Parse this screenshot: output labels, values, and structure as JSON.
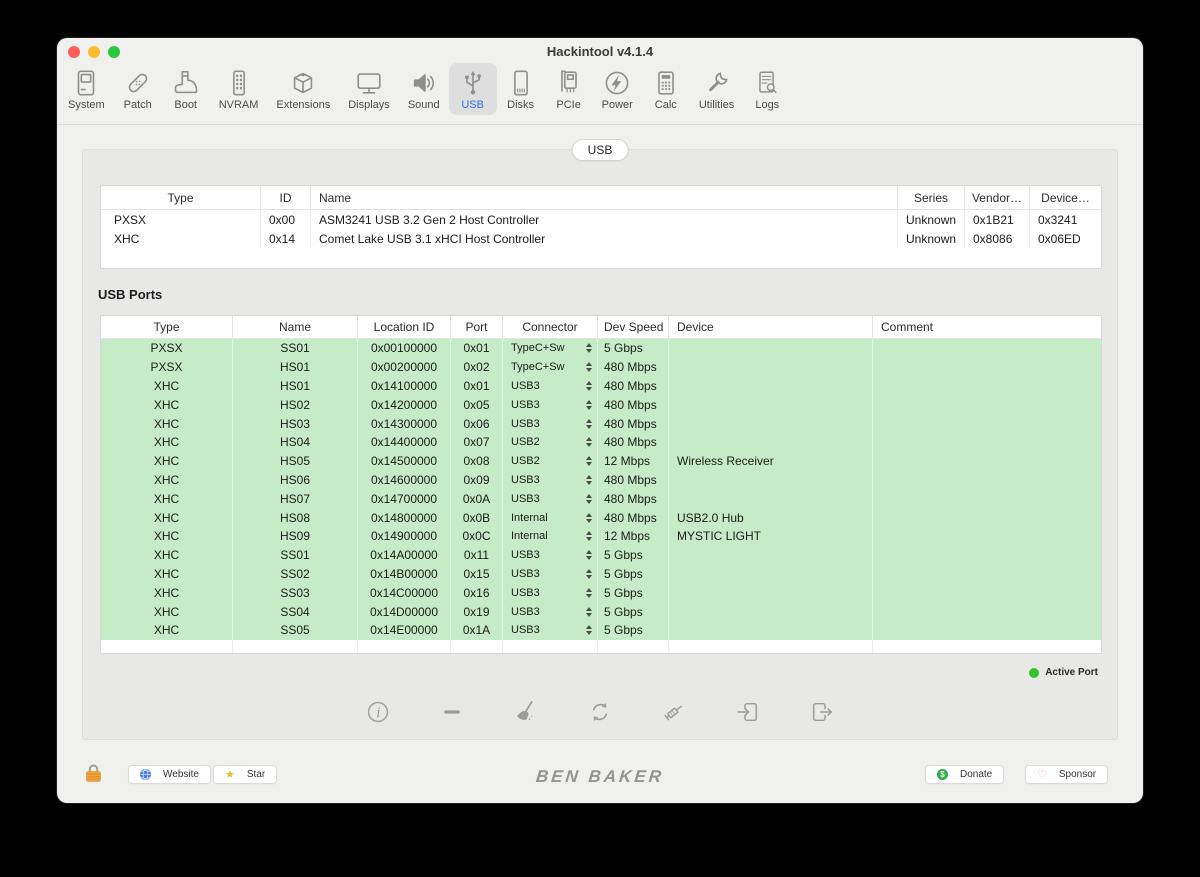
{
  "window": {
    "title": "Hackintool v4.1.4"
  },
  "toolbar": {
    "items": [
      {
        "label": "System",
        "icon": "system",
        "active": false
      },
      {
        "label": "Patch",
        "icon": "patch",
        "active": false
      },
      {
        "label": "Boot",
        "icon": "boot",
        "active": false
      },
      {
        "label": "NVRAM",
        "icon": "nvram",
        "active": false
      },
      {
        "label": "Extensions",
        "icon": "extensions",
        "active": false
      },
      {
        "label": "Displays",
        "icon": "displays",
        "active": false
      },
      {
        "label": "Sound",
        "icon": "sound",
        "active": false
      },
      {
        "label": "USB",
        "icon": "usb",
        "active": true
      },
      {
        "label": "Disks",
        "icon": "disks",
        "active": false
      },
      {
        "label": "PCIe",
        "icon": "pcie",
        "active": false
      },
      {
        "label": "Power",
        "icon": "power",
        "active": false
      },
      {
        "label": "Calc",
        "icon": "calc",
        "active": false
      },
      {
        "label": "Utilities",
        "icon": "utilities",
        "active": false
      },
      {
        "label": "Logs",
        "icon": "logs",
        "active": false
      }
    ]
  },
  "tab": {
    "label": "USB"
  },
  "controllers": {
    "headers": [
      "Type",
      "ID",
      "Name",
      "Series",
      "Vendor…",
      "Device…"
    ],
    "rows": [
      [
        "PXSX",
        "0x00",
        "ASM3241 USB 3.2 Gen 2 Host Controller",
        "Unknown",
        "0x1B21",
        "0x3241"
      ],
      [
        "XHC",
        "0x14",
        "Comet Lake USB 3.1 xHCI Host Controller",
        "Unknown",
        "0x8086",
        "0x06ED"
      ]
    ]
  },
  "usb_ports": {
    "title": "USB Ports",
    "headers": [
      "Type",
      "Name",
      "Location ID",
      "Port",
      "Connector",
      "Dev Speed",
      "Device",
      "Comment"
    ],
    "rows": [
      [
        "PXSX",
        "SS01",
        "0x00100000",
        "0x01",
        "TypeC+Sw",
        "5 Gbps",
        "",
        ""
      ],
      [
        "PXSX",
        "HS01",
        "0x00200000",
        "0x02",
        "TypeC+Sw",
        "480 Mbps",
        "",
        ""
      ],
      [
        "XHC",
        "HS01",
        "0x14100000",
        "0x01",
        "USB3",
        "480 Mbps",
        "",
        ""
      ],
      [
        "XHC",
        "HS02",
        "0x14200000",
        "0x05",
        "USB3",
        "480 Mbps",
        "",
        ""
      ],
      [
        "XHC",
        "HS03",
        "0x14300000",
        "0x06",
        "USB3",
        "480 Mbps",
        "",
        ""
      ],
      [
        "XHC",
        "HS04",
        "0x14400000",
        "0x07",
        "USB2",
        "480 Mbps",
        "",
        ""
      ],
      [
        "XHC",
        "HS05",
        "0x14500000",
        "0x08",
        "USB2",
        "12 Mbps",
        "Wireless Receiver",
        ""
      ],
      [
        "XHC",
        "HS06",
        "0x14600000",
        "0x09",
        "USB3",
        "480 Mbps",
        "",
        ""
      ],
      [
        "XHC",
        "HS07",
        "0x14700000",
        "0x0A",
        "USB3",
        "480 Mbps",
        "",
        ""
      ],
      [
        "XHC",
        "HS08",
        "0x14800000",
        "0x0B",
        "Internal",
        "480 Mbps",
        "USB2.0 Hub",
        ""
      ],
      [
        "XHC",
        "HS09",
        "0x14900000",
        "0x0C",
        "Internal",
        "12 Mbps",
        "MYSTIC LIGHT",
        ""
      ],
      [
        "XHC",
        "SS01",
        "0x14A00000",
        "0x11",
        "USB3",
        "5 Gbps",
        "",
        ""
      ],
      [
        "XHC",
        "SS02",
        "0x14B00000",
        "0x15",
        "USB3",
        "5 Gbps",
        "",
        ""
      ],
      [
        "XHC",
        "SS03",
        "0x14C00000",
        "0x16",
        "USB3",
        "5 Gbps",
        "",
        ""
      ],
      [
        "XHC",
        "SS04",
        "0x14D00000",
        "0x19",
        "USB3",
        "5 Gbps",
        "",
        ""
      ],
      [
        "XHC",
        "SS05",
        "0x14E00000",
        "0x1A",
        "USB3",
        "5 Gbps",
        "",
        ""
      ]
    ]
  },
  "legend": {
    "active_port_label": "Active Port",
    "active_color": "#2ec62e"
  },
  "actions": {
    "items": [
      {
        "name": "info"
      },
      {
        "name": "remove"
      },
      {
        "name": "clean"
      },
      {
        "name": "refresh"
      },
      {
        "name": "inject"
      },
      {
        "name": "import"
      },
      {
        "name": "export"
      }
    ]
  },
  "footer": {
    "logo": "BEN BAKER",
    "website_label": "Website",
    "star_label": "Star",
    "donate_label": "Donate",
    "sponsor_label": "Sponsor"
  },
  "colors": {
    "accent_blue": "#2f6fe4",
    "row_green": "#c6ebc7",
    "active_dot": "#2ec62e",
    "lock_orange": "#f2a33c"
  }
}
